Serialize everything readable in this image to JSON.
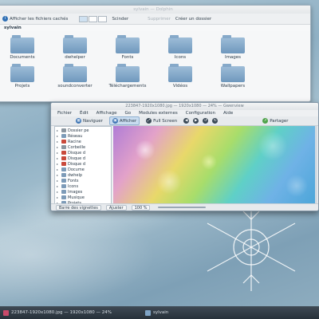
{
  "dolphin": {
    "window_title": "sylvain — Dolphin",
    "toolbar": {
      "show_hidden": "Afficher les fichiers cachés",
      "split": "Scinder",
      "delete": "Supprimer",
      "new_folder": "Créer un dossier"
    },
    "breadcrumb": "sylvain",
    "files": [
      {
        "name": "Documents"
      },
      {
        "name": "dwhelper"
      },
      {
        "name": "Fonts"
      },
      {
        "name": "Icons"
      },
      {
        "name": "Images"
      },
      {
        "name": ""
      },
      {
        "name": "Projets"
      },
      {
        "name": "soundconverter"
      },
      {
        "name": "Téléchargements"
      },
      {
        "name": "Vidéos"
      },
      {
        "name": "Wallpapers"
      },
      {
        "name": ""
      }
    ]
  },
  "gwenview": {
    "window_title": "223847-1920x1080.jpg — 1920x1080 — 24% — Gwenview",
    "menu": [
      "Fichier",
      "Édit",
      "Affichage",
      "Go",
      "Modules externes",
      "Configuration",
      "Aide"
    ],
    "toolbar": {
      "browse": "Naviguer",
      "view": "Afficher",
      "fullscreen": "Full Screen",
      "share": "Partager"
    },
    "sidebar_items": [
      {
        "label": "Dossier pe",
        "icon": "home"
      },
      {
        "label": "Réseau",
        "icon": "network"
      },
      {
        "label": "Racine",
        "icon": "red"
      },
      {
        "label": "Corbeille",
        "icon": "trash"
      },
      {
        "label": "Disque d",
        "icon": "red"
      },
      {
        "label": "Disque d",
        "icon": "red"
      },
      {
        "label": "Disque d",
        "icon": "red"
      },
      {
        "label": "Docume",
        "icon": "folder"
      },
      {
        "label": "dwhelp",
        "icon": "folder"
      },
      {
        "label": "Fonts",
        "icon": "folder"
      },
      {
        "label": "Icons",
        "icon": "folder"
      },
      {
        "label": "Images",
        "icon": "folder"
      },
      {
        "label": "Musique",
        "icon": "folder"
      },
      {
        "label": "Projets",
        "icon": "folder"
      },
      {
        "label": "Télécharg",
        "icon": "folder"
      }
    ],
    "status": {
      "thumbnail_bar": "Barre des vignettes",
      "fit": "Ajuster",
      "zoom": "100 %"
    }
  },
  "taskbar": {
    "tasks": [
      {
        "label": "223847-1920x1080.jpg — 1920x1080 — 24%"
      },
      {
        "label": "sylvain"
      }
    ]
  }
}
